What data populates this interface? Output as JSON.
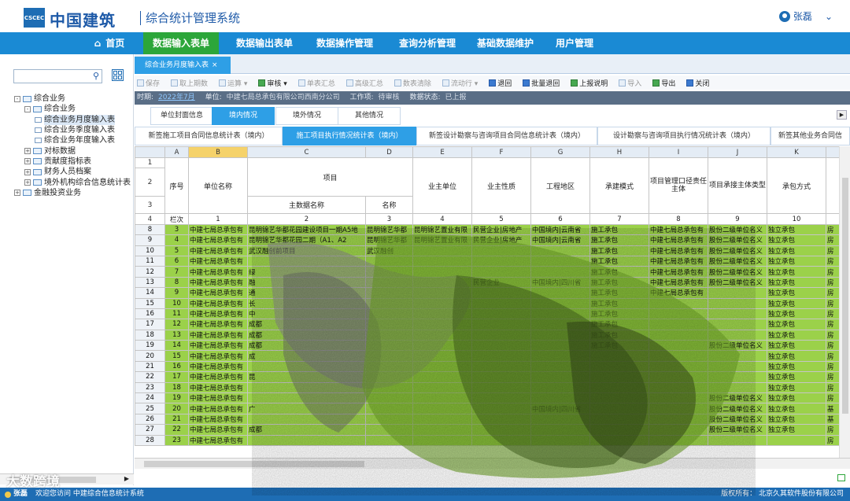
{
  "header": {
    "logo_text": "中国建筑",
    "logo_mark": "CSCEC",
    "system_title": "综合统计管理系统",
    "user_name": "张磊"
  },
  "nav": {
    "items": [
      "首页",
      "数据输入表单",
      "数据输出表单",
      "数据操作管理",
      "查询分析管理",
      "基础数据维护",
      "用户管理"
    ],
    "active": "数据输入表单"
  },
  "sidebar": {
    "search_placeholder": "",
    "tree": [
      {
        "label": "综合业务",
        "level": 0,
        "toggle": "-"
      },
      {
        "label": "综合业务",
        "level": 1,
        "toggle": "-"
      },
      {
        "label": "综合业务月度输入表",
        "level": 2,
        "selected": true
      },
      {
        "label": "综合业务季度输入表",
        "level": 2
      },
      {
        "label": "综合业务年度输入表",
        "level": 2
      },
      {
        "label": "对标数据",
        "level": 1,
        "toggle": "+"
      },
      {
        "label": "贡献度指标表",
        "level": 1,
        "toggle": "+"
      },
      {
        "label": "财务人员档案",
        "level": 1,
        "toggle": "+"
      },
      {
        "label": "境外机构综合信息统计表",
        "level": 1,
        "toggle": "+"
      },
      {
        "label": "金融投资业务",
        "level": 0,
        "toggle": "+"
      }
    ]
  },
  "page_tab": {
    "label": "综合业务月度输入表"
  },
  "toolbar": {
    "items": [
      {
        "label": "保存",
        "enabled": false
      },
      {
        "label": "取上期数",
        "enabled": false
      },
      {
        "label": "运算 ▾",
        "enabled": false
      },
      {
        "label": "审核 ▾",
        "enabled": true
      },
      {
        "label": "单表汇总",
        "enabled": false
      },
      {
        "label": "高级汇总",
        "enabled": false
      },
      {
        "label": "数表清除",
        "enabled": false
      },
      {
        "label": "流动行 ▾",
        "enabled": false
      },
      {
        "label": "退回",
        "enabled": true
      },
      {
        "label": "批量退回",
        "enabled": true
      },
      {
        "label": "上报说明",
        "enabled": true
      },
      {
        "label": "导入",
        "enabled": false
      },
      {
        "label": "导出",
        "enabled": true
      },
      {
        "label": "关闭",
        "enabled": true
      }
    ]
  },
  "infobar": {
    "period_label": "时期:",
    "period_value": "2022年7月",
    "unit_label": "单位:",
    "unit_value": "中建七局总承包有限公司西南分公司",
    "workflow_label": "工作项:",
    "workflow_value": "待审核",
    "status_label": "数据状态:",
    "status_value": "已上报"
  },
  "sub_tabs": [
    "单位封面信息",
    "境内情况",
    "境外情况",
    "其他情况"
  ],
  "sub_tab_active": "境内情况",
  "report_tabs": [
    "新签施工项目合同信息统计表（境内）",
    "施工项目执行情况统计表（境内）",
    "新签设计勘察与咨询项目合同信息统计表（境内）",
    "设计勘察与咨询项目执行情况统计表（境内）",
    "新签其他业务合同信"
  ],
  "report_tab_active": "施工项目执行情况统计表（境内）",
  "sheet": {
    "col_letters": [
      "A",
      "B",
      "C",
      "D",
      "E",
      "F",
      "G",
      "H",
      "I",
      "J",
      "K",
      ""
    ],
    "selected_col": "B",
    "headers": {
      "seq": "序号",
      "unit": "单位名称",
      "project": "项目",
      "main_name": "主数据名称",
      "name": "名称",
      "owner": "业主单位",
      "owner_type": "业主性质",
      "region": "工程地区",
      "mode": "承建模式",
      "mgr": "项目管理口径责任主体",
      "subject": "项目承接主体类型",
      "contract": "承包方式"
    },
    "col_numbers_label": "栏次",
    "col_numbers": [
      "1",
      "2",
      "3",
      "4",
      "5",
      "6",
      "7",
      "8",
      "9",
      "10"
    ],
    "rows": [
      {
        "r": "8",
        "seq": "3",
        "unit": "中建七局总承包有",
        "main": "昆明锦艺华都花园建设项目一期A5地",
        "name": "昆明锦艺华都",
        "owner": "昆明锦艺置业有限",
        "otype": "民营企业|房地产",
        "region": "中国境内|云南省",
        "mode": "施工承包",
        "mgr": "中建七局总承包有",
        "subj": "股份二级单位名义",
        "cont": "独立承包",
        "x": "房"
      },
      {
        "r": "9",
        "seq": "4",
        "unit": "中建七局总承包有",
        "main": "昆明锦艺华都花园二期（A1、A2",
        "name": "昆明锦艺华都",
        "owner": "昆明锦艺置业有限",
        "otype": "民营企业|房地产",
        "region": "中国境内|云南省",
        "mode": "施工承包",
        "mgr": "中建七局总承包有",
        "subj": "股份二级单位名义",
        "cont": "独立承包",
        "x": "房"
      },
      {
        "r": "10",
        "seq": "5",
        "unit": "中建七局总承包有",
        "main": "武汉融创前项目",
        "name": "武汉融创",
        "owner": "",
        "otype": "",
        "region": "",
        "mode": "施工承包",
        "mgr": "中建七局总承包有",
        "subj": "股份二级单位名义",
        "cont": "独立承包",
        "x": "房"
      },
      {
        "r": "11",
        "seq": "6",
        "unit": "中建七局总承包有",
        "main": "",
        "name": "",
        "owner": "",
        "otype": "",
        "region": "",
        "mode": "施工承包",
        "mgr": "中建七局总承包有",
        "subj": "股份二级单位名义",
        "cont": "独立承包",
        "x": "房"
      },
      {
        "r": "12",
        "seq": "7",
        "unit": "中建七局总承包有",
        "main": "绿",
        "name": "",
        "owner": "",
        "otype": "",
        "region": "",
        "mode": "施工承包",
        "mgr": "中建七局总承包有",
        "subj": "股份二级单位名义",
        "cont": "独立承包",
        "x": "房"
      },
      {
        "r": "13",
        "seq": "8",
        "unit": "中建七局总承包有",
        "main": "融",
        "name": "",
        "owner": "",
        "otype": "民营企业",
        "region": "中国境内|四川省",
        "mode": "施工承包",
        "mgr": "中建七局总承包有",
        "subj": "股份二级单位名义",
        "cont": "独立承包",
        "x": "房"
      },
      {
        "r": "14",
        "seq": "9",
        "unit": "中建七局总承包有",
        "main": "通",
        "name": "",
        "owner": "",
        "otype": "",
        "region": "",
        "mode": "施工承包",
        "mgr": "中建七局总承包有",
        "subj": "",
        "cont": "独立承包",
        "x": "房"
      },
      {
        "r": "15",
        "seq": "10",
        "unit": "中建七局总承包有",
        "main": "长",
        "name": "",
        "owner": "",
        "otype": "",
        "region": "",
        "mode": "施工承包",
        "mgr": "",
        "subj": "",
        "cont": "独立承包",
        "x": "房"
      },
      {
        "r": "16",
        "seq": "11",
        "unit": "中建七局总承包有",
        "main": "中",
        "name": "",
        "owner": "",
        "otype": "",
        "region": "",
        "mode": "施工承包",
        "mgr": "",
        "subj": "",
        "cont": "独立承包",
        "x": "房"
      },
      {
        "r": "17",
        "seq": "12",
        "unit": "中建七局总承包有",
        "main": "成都",
        "name": "",
        "owner": "",
        "otype": "",
        "region": "",
        "mode": "施工承包",
        "mgr": "",
        "subj": "",
        "cont": "独立承包",
        "x": "房"
      },
      {
        "r": "18",
        "seq": "13",
        "unit": "中建七局总承包有",
        "main": "成都",
        "name": "",
        "owner": "",
        "otype": "",
        "region": "",
        "mode": "施工承包",
        "mgr": "",
        "subj": "",
        "cont": "独立承包",
        "x": "房"
      },
      {
        "r": "19",
        "seq": "14",
        "unit": "中建七局总承包有",
        "main": "成都",
        "name": "",
        "owner": "",
        "otype": "",
        "region": "",
        "mode": "施工承包",
        "mgr": "",
        "subj": "股份二级单位名义",
        "cont": "独立承包",
        "x": "房"
      },
      {
        "r": "20",
        "seq": "15",
        "unit": "中建七局总承包有",
        "main": "成",
        "name": "",
        "owner": "",
        "otype": "",
        "region": "",
        "mode": "",
        "mgr": "",
        "subj": "",
        "cont": "独立承包",
        "x": "房"
      },
      {
        "r": "21",
        "seq": "16",
        "unit": "中建七局总承包有",
        "main": "",
        "name": "",
        "owner": "",
        "otype": "",
        "region": "",
        "mode": "",
        "mgr": "",
        "subj": "",
        "cont": "独立承包",
        "x": "房"
      },
      {
        "r": "22",
        "seq": "17",
        "unit": "中建七局总承包有",
        "main": "昆",
        "name": "",
        "owner": "",
        "otype": "",
        "region": "",
        "mode": "",
        "mgr": "",
        "subj": "",
        "cont": "独立承包",
        "x": "房"
      },
      {
        "r": "23",
        "seq": "18",
        "unit": "中建七局总承包有",
        "main": "",
        "name": "",
        "owner": "",
        "otype": "",
        "region": "",
        "mode": "",
        "mgr": "",
        "subj": "",
        "cont": "独立承包",
        "x": "房"
      },
      {
        "r": "24",
        "seq": "19",
        "unit": "中建七局总承包有",
        "main": "",
        "name": "",
        "owner": "",
        "otype": "",
        "region": "",
        "mode": "",
        "mgr": "",
        "subj": "股份二级单位名义",
        "cont": "独立承包",
        "x": "房"
      },
      {
        "r": "25",
        "seq": "20",
        "unit": "中建七局总承包有",
        "main": "广",
        "name": "",
        "owner": "",
        "otype": "",
        "region": "中国境内|四川省",
        "mode": "",
        "mgr": "",
        "subj": "股份二级单位名义",
        "cont": "独立承包",
        "x": "基"
      },
      {
        "r": "26",
        "seq": "21",
        "unit": "中建七局总承包有",
        "main": "",
        "name": "",
        "owner": "",
        "otype": "",
        "region": "",
        "mode": "",
        "mgr": "",
        "subj": "股份二级单位名义",
        "cont": "独立承包",
        "x": "基"
      },
      {
        "r": "27",
        "seq": "22",
        "unit": "中建七局总承包有",
        "main": "成都",
        "name": "",
        "owner": "",
        "otype": "",
        "region": "",
        "mode": "",
        "mgr": "",
        "subj": "股份二级单位名义",
        "cont": "独立承包",
        "x": "房"
      },
      {
        "r": "28",
        "seq": "23",
        "unit": "中建七局总承包有",
        "main": "",
        "name": "",
        "owner": "",
        "otype": "",
        "region": "",
        "mode": "",
        "mgr": "",
        "subj": "",
        "cont": "",
        "x": "房"
      }
    ]
  },
  "footer": {
    "user": "张磊",
    "welcome": "欢迎您访问 中建综合信息统计系统",
    "copyright": "版权所有：  北京久其软件股份有限公司"
  },
  "watermark": "大数跨境",
  "colors": {
    "brand_blue": "#1e6db4",
    "nav_blue": "#1a8ad4",
    "active_green": "#2ca63a",
    "cell_green": "#9bd14a",
    "tab_blue": "#2e9fe6"
  }
}
